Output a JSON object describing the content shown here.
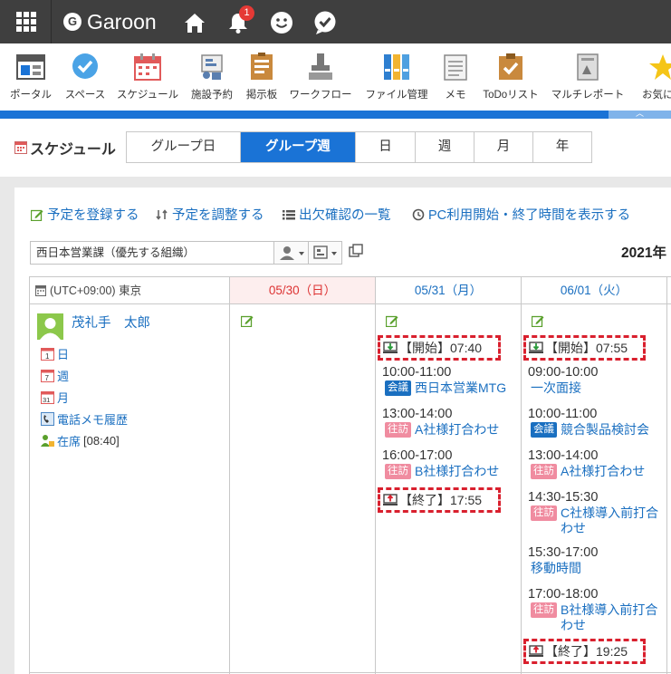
{
  "header": {
    "brand": "Garoon",
    "brand_initial": "G",
    "notification_count": "1"
  },
  "apps": [
    {
      "label": "ポータル",
      "icon": "portal-icon"
    },
    {
      "label": "スペース",
      "icon": "space-icon"
    },
    {
      "label": "スケジュール",
      "icon": "schedule-icon"
    },
    {
      "label": "施設予約",
      "icon": "facility-icon"
    },
    {
      "label": "掲示板",
      "icon": "bulletin-icon"
    },
    {
      "label": "ワークフロー",
      "icon": "workflow-icon"
    },
    {
      "label": "ファイル管理",
      "icon": "file-icon"
    },
    {
      "label": "メモ",
      "icon": "memo-icon"
    },
    {
      "label": "ToDoリスト",
      "icon": "todo-icon"
    },
    {
      "label": "マルチレポート",
      "icon": "report-icon"
    },
    {
      "label": "お気に入",
      "icon": "favorite-icon"
    }
  ],
  "page": {
    "title": "スケジュール",
    "tabs": [
      "グループ日",
      "グループ週",
      "日",
      "週",
      "月",
      "年"
    ],
    "active_tab": "グループ週"
  },
  "actions": {
    "register": "予定を登録する",
    "adjust": "予定を調整する",
    "attendance": "出欠確認の一覧",
    "pc_time": "PC利用開始・終了時間を表示する"
  },
  "org": {
    "value": "西日本営業課（優先する組織）"
  },
  "year_label": "2021年",
  "timezone": "(UTC+09:00) 東京",
  "days": [
    {
      "label": "05/30（日）",
      "sunday": true
    },
    {
      "label": "05/31（月）",
      "sunday": false
    },
    {
      "label": "06/01（火）",
      "sunday": false
    }
  ],
  "user": {
    "name": "茂礼手　太郎",
    "links": {
      "day": "日",
      "week": "週",
      "month": "月",
      "phone_memo": "電話メモ履歴",
      "presence": "在席",
      "presence_time": "[08:40]"
    }
  },
  "day1": {
    "pc_start": "【開始】07:40",
    "pc_end": "【終了】17:55",
    "events": [
      {
        "time": "10:00-11:00",
        "category": "会議",
        "title": "西日本営業MTG"
      },
      {
        "time": "13:00-14:00",
        "category": "往訪",
        "title": "A社様打合わせ"
      },
      {
        "time": "16:00-17:00",
        "category": "往訪",
        "title": "B社様打合わせ"
      }
    ]
  },
  "day2": {
    "pc_start": "【開始】07:55",
    "pc_end": "【終了】19:25",
    "events": [
      {
        "time": "09:00-10:00",
        "title": "一次面接"
      },
      {
        "time": "10:00-11:00",
        "category": "会議",
        "title": "競合製品検討会"
      },
      {
        "time": "13:00-14:00",
        "category": "往訪",
        "title": "A社様打合わせ"
      },
      {
        "time": "14:30-15:30",
        "category": "往訪",
        "title_line1": "C社様導入前打合",
        "title_line2": "わせ"
      },
      {
        "time": "15:30-17:00",
        "title": "移動時間"
      },
      {
        "time": "17:00-18:00",
        "category": "往訪",
        "title_line1": "B社様導入前打合",
        "title_line2": "わせ"
      }
    ]
  },
  "colors": {
    "accent": "#1a73d6",
    "header_bg": "#3f3f3f",
    "meeting_tag": "#1a6fc0",
    "visit_tag": "#f08ca0",
    "pc_highlight": "#d9202e"
  }
}
